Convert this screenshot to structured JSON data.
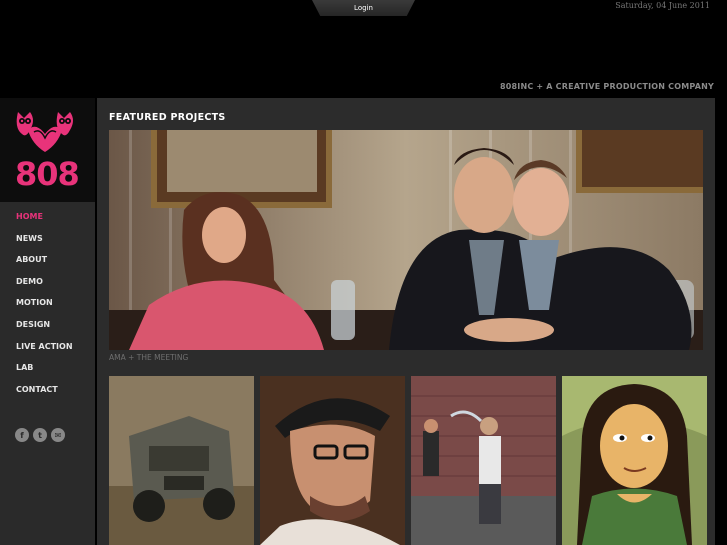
{
  "header": {
    "login_label": "Login",
    "date": "Saturday, 04 June 2011",
    "tagline": "808INC + A CREATIVE PRODUCTION COMPANY"
  },
  "brand": {
    "logo_text": "808",
    "accent_color": "#e8337a"
  },
  "nav": {
    "items": [
      {
        "label": "HOME",
        "active": true
      },
      {
        "label": "NEWS"
      },
      {
        "label": "ABOUT"
      },
      {
        "label": "DEMO"
      },
      {
        "label": "MOTION"
      },
      {
        "label": "DESIGN"
      },
      {
        "label": "LIVE ACTION"
      },
      {
        "label": "LAB"
      },
      {
        "label": "CONTACT"
      }
    ]
  },
  "social": {
    "icons": [
      "facebook-icon",
      "twitter-icon",
      "email-icon"
    ]
  },
  "main": {
    "section_title": "FEATURED PROJECTS",
    "feature_caption": "AMA + THE MEETING",
    "thumbnails": [
      "armored-truck",
      "man-in-hat",
      "street-dancers",
      "mona-lisa-cartoon"
    ]
  }
}
